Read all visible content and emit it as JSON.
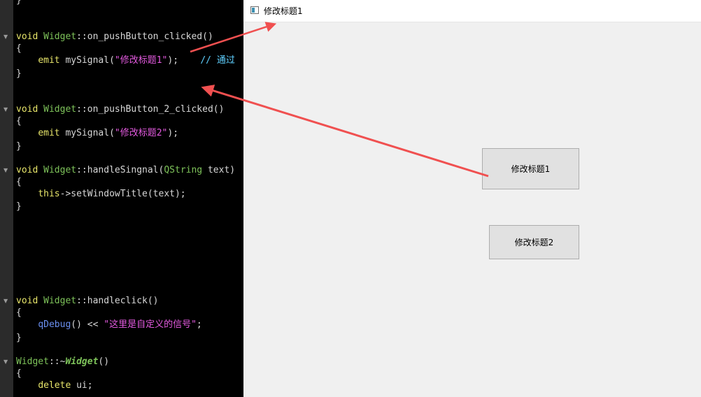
{
  "editor": {
    "top_fragment": "}",
    "lines": {
      "l1": [
        "void",
        "Widget",
        "::on_pushButton_clicked()"
      ],
      "l2": "{",
      "l3": [
        "emit",
        "mySignal(",
        "\"修改标题1\"",
        ");",
        "// 通过"
      ],
      "l4": "}",
      "l5": [
        "void",
        "Widget",
        "::on_pushButton_2_clicked()"
      ],
      "l6": "{",
      "l7": [
        "emit",
        "mySignal(",
        "\"修改标题2\"",
        ");"
      ],
      "l8": "}",
      "l9": [
        "void",
        "Widget",
        "::handleSingnal(",
        "QString",
        " text)"
      ],
      "l10": "{",
      "l11": [
        "this",
        "->setWindowTitle(text);"
      ],
      "l12": "}",
      "l13": [
        "void",
        "Widget",
        "::handleclick()"
      ],
      "l14": "{",
      "l15": [
        "qDebug",
        "() << ",
        "\"这里是自定义的信号\"",
        ";"
      ],
      "l16": "}",
      "l17": [
        "Widget",
        "::~",
        "Widget",
        "()"
      ],
      "l18": "{",
      "l19": [
        "delete",
        " ui;"
      ]
    }
  },
  "window": {
    "title": "修改标题1",
    "button1_label": "修改标题1",
    "button2_label": "修改标题2"
  },
  "colors": {
    "arrow": "#f05050",
    "window_bg": "#f0f0f0",
    "button_bg": "#e1e1e1"
  }
}
